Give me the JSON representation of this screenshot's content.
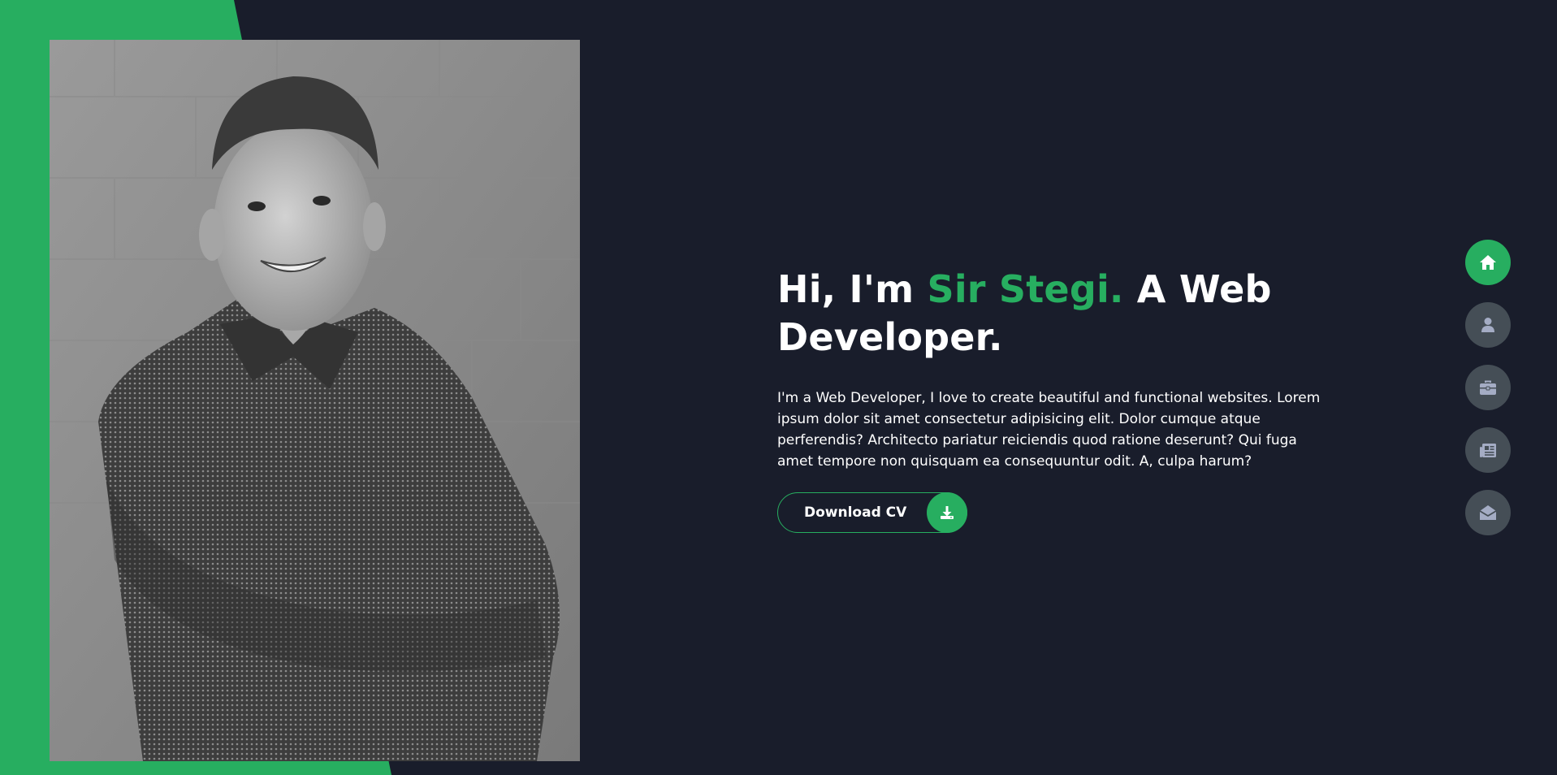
{
  "hero": {
    "headline_part1": "Hi, I'm ",
    "headline_name": "Sir Stegi.",
    "headline_part2": " A Web Developer.",
    "bio": "I'm a Web Developer, I love to create beautiful and functional websites. Lorem ipsum dolor sit amet consectetur adipisicing elit. Dolor cumque atque perferendis? Architecto pariatur reiciendis quod ratione deserunt? Qui fuga amet tempore non quisquam ea consequuntur odit. A, culpa harum?",
    "cv_button_label": "Download CV",
    "cv_button_icon": "download-icon",
    "portrait_image": "portrait-photo"
  },
  "nav": {
    "items": [
      {
        "icon": "home-icon",
        "active": true
      },
      {
        "icon": "user-icon",
        "active": false
      },
      {
        "icon": "briefcase-icon",
        "active": false
      },
      {
        "icon": "newspaper-icon",
        "active": false
      },
      {
        "icon": "envelope-open-icon",
        "active": false
      }
    ]
  },
  "colors": {
    "background": "#191d2b",
    "accent": "#27ae60",
    "nav_button": "#454e56",
    "text": "#ffffff",
    "nav_icon": "#a4acc4"
  }
}
